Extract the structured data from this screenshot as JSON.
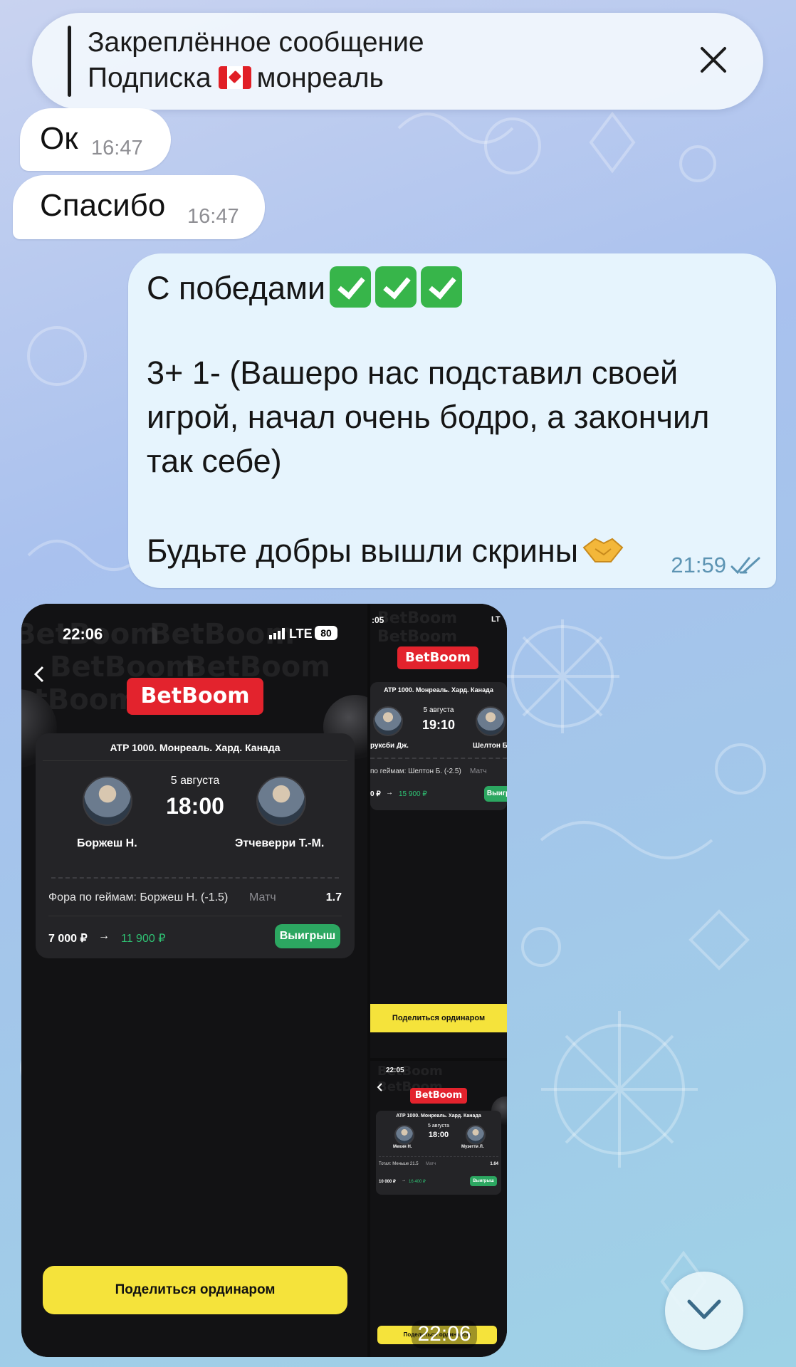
{
  "pinned": {
    "title": "Закреплённое сообщение",
    "text_before": "Подписка",
    "text_after": "монреаль",
    "flag_icon": "flag-canada-icon",
    "close_icon": "close-icon"
  },
  "messages": [
    {
      "text": "Ок",
      "time": "16:47"
    },
    {
      "text": "Спасибо",
      "time": "16:47"
    }
  ],
  "outgoing": {
    "line1": "С победами",
    "line2": "3+ 1- (Вашеро нас подставил своей",
    "line3": "игрой, начал очень бодро, а закончил",
    "line4": "так себе)",
    "line5": "Будьте добры вышли скрины",
    "time": "21:59"
  },
  "screenshot1": {
    "status_time": "22:06",
    "network": "LTE",
    "battery": "80",
    "logo": "BetBoom",
    "watermark": "BetBoom",
    "event": "ATP 1000. Монреаль. Хард. Канада",
    "date": "5 августа",
    "start": "18:00",
    "player1": "Боржеш Н.",
    "player2": "Этчеверри Т.-М.",
    "bet": "Фора по геймам: Боржеш Н. (-1.5)",
    "bet_kind": "Матч",
    "odds": "1.7",
    "stake": "7 000 ₽",
    "arrow": "→",
    "payout": "11 900 ₽",
    "status": "Выигрыш",
    "share": "Поделиться ординаром"
  },
  "screenshot2": {
    "status_time": ":05",
    "network": "LT",
    "logo": "BetBoom",
    "event": "ATP 1000. Монреаль. Хард. Канада",
    "date": "5 августа",
    "start": "19:10",
    "player1": "руксби Дж.",
    "player2": "Шелтон Б",
    "bet": "по геймам: Шелтон Б. (-2.5)",
    "bet_kind": "Матч",
    "stake": "0 ₽",
    "arrow": "→",
    "payout": "15 900 ₽",
    "status": "Выигр",
    "share": "Поделиться ординаром"
  },
  "screenshot3": {
    "status_time": "22:05",
    "logo": "BetBoom",
    "event": "ATP 1000. Монреаль. Хард. Канада",
    "date": "5 августа",
    "start": "18:00",
    "player1": "Мехия Н.",
    "player2": "Музетти Л.",
    "bet": "Тотал: Меньше 21.5",
    "bet_kind": "Матч",
    "odds": "1.64",
    "stake": "10 000 ₽",
    "arrow": "→",
    "payout": "16 400 ₽",
    "status": "Выигрыш",
    "share": "Поделиться ординаром"
  },
  "media_time": "22:06",
  "scroll_icon": "chevron-down-icon",
  "colors": {
    "accent_green": "#2fc374",
    "brand_red": "#e3232d",
    "share_yellow": "#f5e33b",
    "outgoing_bubble": "#e6f4fd"
  }
}
